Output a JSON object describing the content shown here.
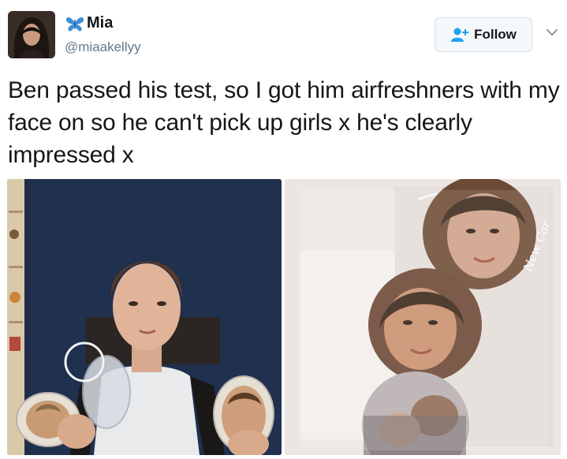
{
  "user": {
    "display_name": "Mia",
    "handle": "@miaakellyy",
    "name_emoji_icon": "butterfly-icon",
    "avatar_icon": "profile-photo"
  },
  "actions": {
    "follow_label": "Follow",
    "follow_icon": "add-user-icon",
    "more_icon": "chevron-down-icon"
  },
  "tweet": {
    "text": "Ben passed his test, so I got him airfreshners with my face on so he can't pick up girls x he's clearly impressed x"
  },
  "media": {
    "photo_count": 2,
    "air_freshener_label": "New Car"
  },
  "colors": {
    "accent_blue": "#1da1f2",
    "text_primary": "#14171a",
    "text_secondary": "#657786",
    "button_bg": "#f5f8fa",
    "button_border": "#d8e0e6"
  }
}
